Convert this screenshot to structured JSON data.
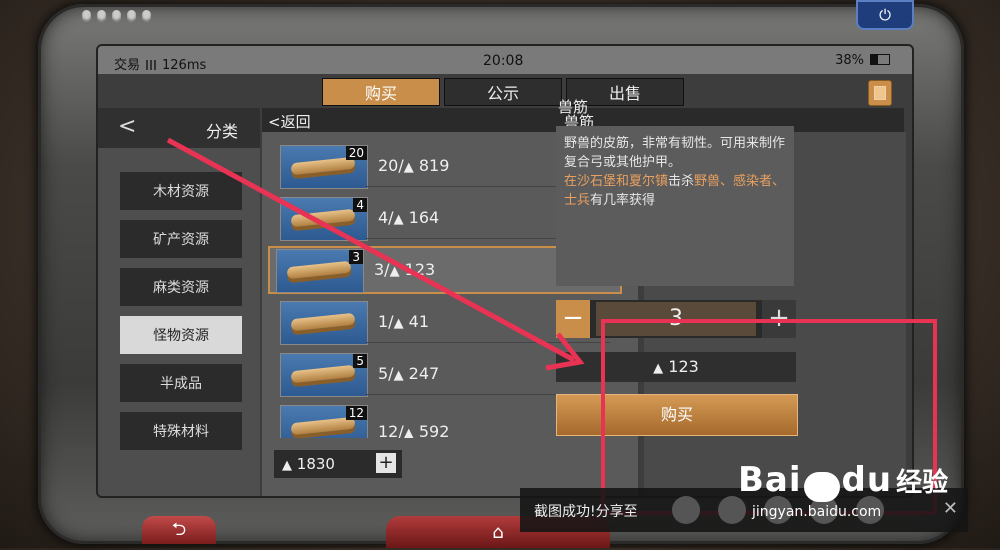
{
  "status": {
    "carrier": "交易",
    "ping": "126ms",
    "time": "20:08",
    "battery": "38%"
  },
  "tabs": [
    {
      "label": "购买"
    },
    {
      "label": "公示"
    },
    {
      "label": "出售"
    }
  ],
  "categories": {
    "title": "分类",
    "items": [
      {
        "label": "木材资源"
      },
      {
        "label": "矿产资源"
      },
      {
        "label": "麻类资源"
      },
      {
        "label": "怪物资源"
      },
      {
        "label": "半成品"
      },
      {
        "label": "特殊材料"
      }
    ]
  },
  "list": {
    "back_label": "返回",
    "title": "兽筋",
    "rows": [
      {
        "qty": "20",
        "label": "20/",
        "price": "819"
      },
      {
        "qty": "4",
        "label": "4/",
        "price": "164"
      },
      {
        "qty": "3",
        "label": "3/",
        "price": "123"
      },
      {
        "qty": "",
        "label": "1/",
        "price": "41"
      },
      {
        "qty": "5",
        "label": "5/",
        "price": "247"
      },
      {
        "qty": "12",
        "label": "12/",
        "price": "592"
      }
    ],
    "balance": "1830"
  },
  "detail": {
    "title": "兽筋",
    "desc_line1": "野兽的皮筋，非常有韧性。可用来制作复合弓或其他护甲。",
    "desc_pre": "在",
    "desc_loc": "沙石堡和夏尔镇",
    "desc_mid": "击杀",
    "desc_mobs1": "野兽、感染者、士兵",
    "desc_post": "有几率获得",
    "quantity": "3",
    "total": "123",
    "buy_label": "购买"
  },
  "toast": {
    "text": "截图成功!分享至"
  },
  "watermark": {
    "brand": "Bai",
    "brand2": "du",
    "cn": "经验",
    "url": "jingyan.baidu.com"
  },
  "colors": {
    "accent": "#c98e4a",
    "annotation": "#e83355"
  }
}
